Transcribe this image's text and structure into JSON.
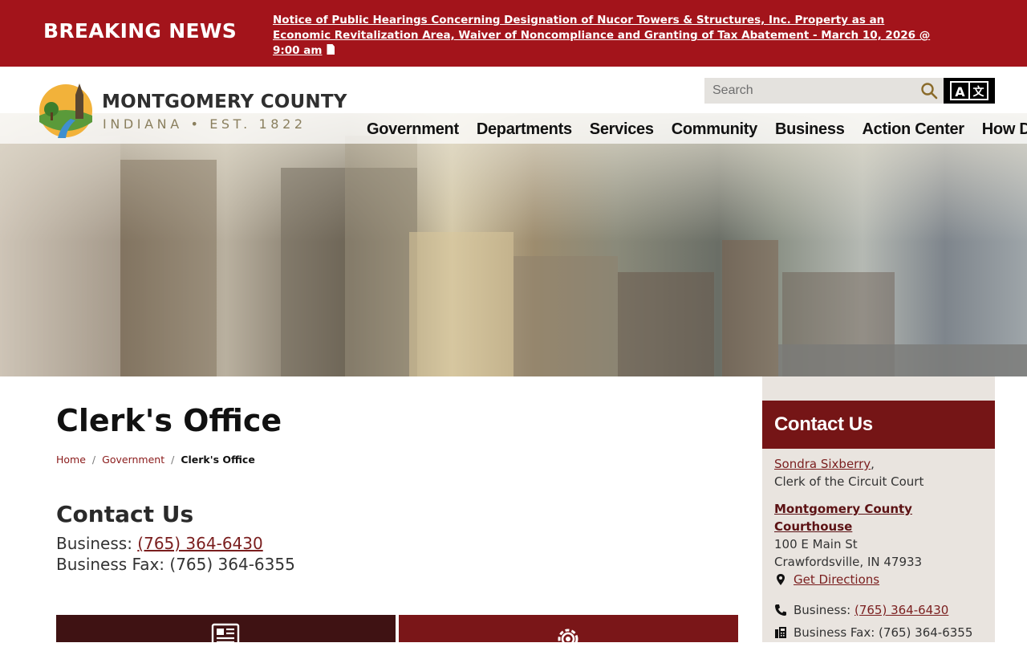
{
  "breaking": {
    "label": "BREAKING NEWS",
    "headline": "Notice of Public Hearings Concerning Designation of Nucor Towers & Structures, Inc. Property as an Economic Revitalization Area, Waiver of Noncompliance and Granting of Tax Abatement - March 10, 2026 @ 9:00 am",
    "icon": "pdf-file-icon"
  },
  "logo": {
    "title": "MONTGOMERY COUNTY",
    "subtitle": "INDIANA • EST. 1822"
  },
  "search": {
    "placeholder": "Search",
    "icon": "search-icon"
  },
  "translate": {
    "icon": "translate-icon"
  },
  "nav": {
    "items": [
      "Government",
      "Departments",
      "Services",
      "Community",
      "Business",
      "Action Center",
      "How Do I..."
    ]
  },
  "page": {
    "title": "Clerk's Office"
  },
  "breadcrumb": {
    "home": "Home",
    "parent": "Government",
    "current": "Clerk's Office",
    "separator": "/"
  },
  "contact": {
    "heading": "Contact Us",
    "business_label": "Business:",
    "business_phone": "(765) 364-6430",
    "fax_line": "Business Fax: (765) 364-6355"
  },
  "tiles": [
    {
      "icon": "newspaper-icon"
    },
    {
      "icon": "gear-icon"
    }
  ],
  "sidebar": {
    "heading": "Contact Us",
    "person_name": "Sondra Sixberry",
    "person_suffix": ",",
    "person_title": "Clerk of the Circuit Court",
    "location_line1": "Montgomery County",
    "location_line2": "Courthouse",
    "address1": "100 E Main St",
    "address2": "Crawfordsville, IN 47933",
    "directions": "Get Directions",
    "business_label": "Business:",
    "business_phone": "(765) 364-6430",
    "fax_line": "Business Fax: (765) 364-6355"
  },
  "colors": {
    "brand_red": "#a3141b",
    "sidebar_head": "#751516",
    "link": "#7a1e1e"
  }
}
